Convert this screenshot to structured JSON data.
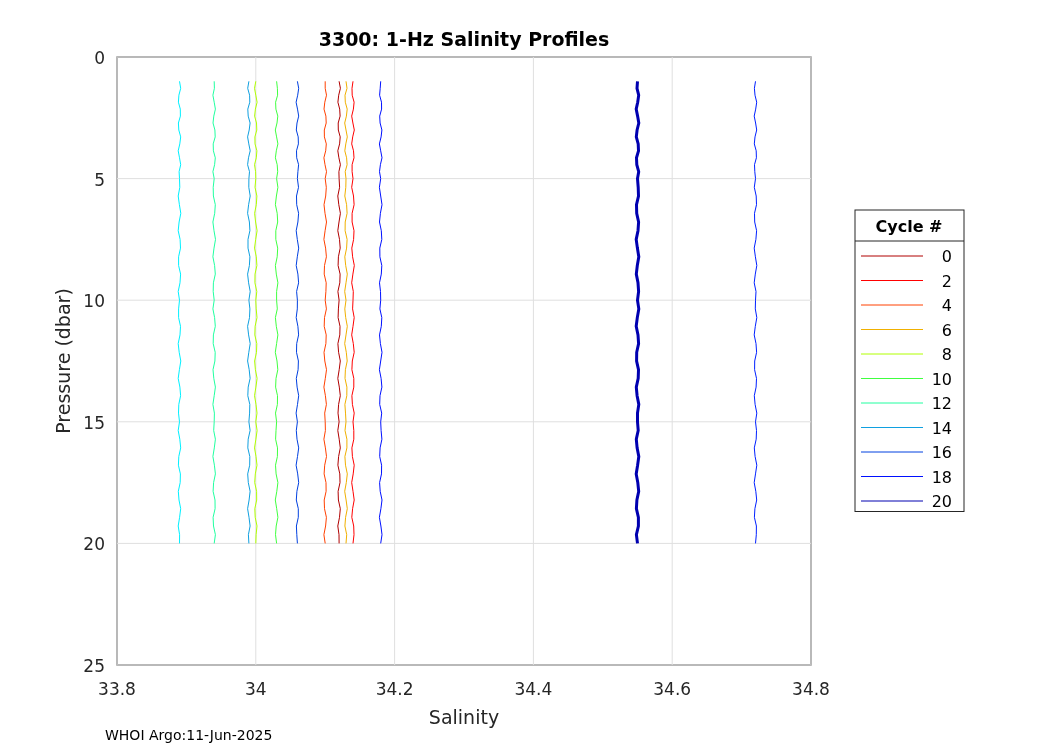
{
  "figure": {
    "footer": "WHOI Argo:11-Jun-2025",
    "chart_data": {
      "type": "line",
      "title": "3300: 1-Hz Salinity Profiles",
      "xlabel": "Salinity",
      "ylabel": "Pressure (dbar)",
      "orientation": "horizontal",
      "grid": true,
      "legend": {
        "title": "Cycle #"
      },
      "x": [
        1,
        5,
        10,
        15,
        20
      ],
      "series": [
        {
          "name": "0",
          "color": "#b00000",
          "values": [
            34.12,
            34.12,
            34.12,
            34.12,
            34.12
          ]
        },
        {
          "name": "2",
          "color": "#ff0000",
          "values": [
            34.14,
            34.14,
            34.14,
            34.14,
            34.14
          ]
        },
        {
          "name": "4",
          "color": "#ff4000",
          "values": [
            34.1,
            34.1,
            34.1,
            34.1,
            34.1
          ]
        },
        {
          "name": "6",
          "color": "#f0b000",
          "values": [
            34.13,
            34.13,
            34.13,
            34.13,
            34.13
          ]
        },
        {
          "name": "8",
          "color": "#b0ff00",
          "values": [
            34.0,
            34.0,
            34.0,
            34.0,
            34.0
          ]
        },
        {
          "name": "10",
          "color": "#40ff40",
          "values": [
            34.03,
            34.03,
            34.03,
            34.03,
            34.03
          ]
        },
        {
          "name": "12",
          "color": "#20ffa0",
          "values": [
            33.94,
            33.94,
            33.94,
            33.94,
            33.94
          ]
        },
        {
          "name": "14",
          "color": "#10a0e0",
          "values": [
            33.99,
            33.99,
            33.99,
            33.99,
            33.99
          ]
        },
        {
          "name": "16",
          "color": "#0040e0",
          "values": [
            34.06,
            34.06,
            34.06,
            34.06,
            34.06
          ]
        },
        {
          "name": "18",
          "color": "#0010ff",
          "values": [
            34.18,
            34.18,
            34.18,
            34.18,
            34.18
          ]
        },
        {
          "name": "20",
          "color": "#0000b0",
          "values": [
            34.55,
            34.55,
            34.55,
            34.55,
            34.55
          ]
        },
        {
          "color": "#00f0ff",
          "values": [
            33.89,
            33.89,
            33.89,
            33.89,
            33.89
          ]
        },
        {
          "color": "#0020ff",
          "values": [
            34.72,
            34.72,
            34.72,
            34.72,
            34.72
          ]
        }
      ],
      "xlim": [
        33.8,
        34.8
      ],
      "ylim": [
        25,
        0
      ],
      "xticks": [
        {
          "value": 33.8,
          "label": "33.8"
        },
        {
          "value": 34,
          "label": "34"
        },
        {
          "value": 34.2,
          "label": "34.2"
        },
        {
          "value": 34.4,
          "label": "34.4"
        },
        {
          "value": 34.6,
          "label": "34.6"
        },
        {
          "value": 34.8,
          "label": "34.8"
        }
      ],
      "yticks": [
        {
          "value": 0,
          "label": "0"
        },
        {
          "value": 5,
          "label": "5"
        },
        {
          "value": 10,
          "label": "10"
        },
        {
          "value": 15,
          "label": "15"
        },
        {
          "value": 20,
          "label": "20"
        },
        {
          "value": 25,
          "label": "25"
        }
      ]
    }
  }
}
